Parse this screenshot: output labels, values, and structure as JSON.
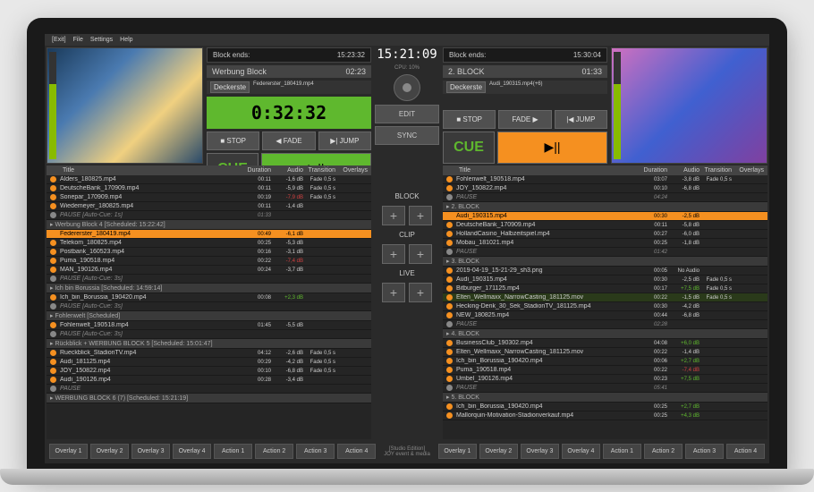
{
  "menu": {
    "exit": "[Exit]",
    "file": "File",
    "settings": "Settings",
    "help": "Help"
  },
  "deckA": {
    "block_ends_label": "Block ends:",
    "block_ends": "15:23:32",
    "title": "Werbung Block",
    "remain": "02:23",
    "file_btn": "Deckerste",
    "file": "Federerster_180419.mp4",
    "timer": "0:32:32",
    "stop": "■ STOP",
    "fade": "◀ FADE",
    "jump": "▶| JUMP",
    "cue": "CUE",
    "play": "▶||"
  },
  "deckB": {
    "block_ends_label": "Block ends:",
    "block_ends": "15:30:04",
    "title": "2. BLOCK",
    "remain": "01:33",
    "file_btn": "Deckerste",
    "file": "Audi_190315.mp4(+6)",
    "stop": "■ STOP",
    "fade": "FADE ▶",
    "jump": "|◀ JUMP",
    "cue": "CUE",
    "play": "▶||"
  },
  "center": {
    "clock": "15:21:09",
    "cpu": "CPU: 10%",
    "edit": "EDIT",
    "sync": "SYNC"
  },
  "mid": {
    "block": "BLOCK",
    "clip": "CLIP",
    "live": "LIVE"
  },
  "cols": {
    "title": "Title",
    "duration": "Duration",
    "audio": "Audio",
    "transition": "Transition",
    "overlays": "Overlays"
  },
  "playlistA": {
    "blocks": [
      {
        "header": "",
        "rows": [
          {
            "t": "Alders_180825.mp4",
            "d": "00:11",
            "a": "-1,6 dB",
            "tr": "Fade 0,5 s"
          },
          {
            "t": "DeutscheBank_170909.mp4",
            "d": "00:11",
            "a": "-5,9 dB",
            "tr": "Fade 0,5 s"
          },
          {
            "t": "Sonepar_170909.mp4",
            "d": "00:19",
            "a": "-7,9 dB",
            "tr": "Fade 0,5 s"
          },
          {
            "t": "Wiedemeyer_180825.mp4",
            "d": "00:11",
            "a": "-1,4 dB",
            "tr": ""
          },
          {
            "t": "PAUSE [Auto-Cue: 1s]",
            "d": "01:33",
            "pause": true
          }
        ]
      },
      {
        "header": "Werbung Block 4 [Scheduled: 15:22:42]",
        "orange": true,
        "rows": [
          {
            "t": "Federerster_180419.mp4",
            "d": "00:49",
            "a": "-6,1 dB",
            "tr": "",
            "hl": "orange"
          },
          {
            "t": "Telekom_180825.mp4",
            "d": "00:25",
            "a": "-5,3 dB",
            "tr": ""
          },
          {
            "t": "Postbank_160523.mp4",
            "d": "00:16",
            "a": "-3,1 dB",
            "tr": ""
          },
          {
            "t": "Puma_190518.mp4",
            "d": "00:22",
            "a": "-7,4 dB",
            "tr": ""
          },
          {
            "t": "MAN_190126.mp4",
            "d": "00:24",
            "a": "-3,7 dB",
            "tr": ""
          },
          {
            "t": "PAUSE [Auto-Cue: 3s]",
            "d": "",
            "pause": true
          }
        ]
      },
      {
        "header": "Ich bin Borussia [Scheduled: 14:59:14]",
        "rows": [
          {
            "t": "Ich_bin_Borussia_190420.mp4",
            "d": "00:08",
            "a": "+2,3 dB",
            "tr": ""
          },
          {
            "t": "PAUSE [Auto-Cue: 3s]",
            "d": "",
            "pause": true
          }
        ]
      },
      {
        "header": "Fohlenwelt [Scheduled]",
        "rows": [
          {
            "t": "Fohlenwelt_190518.mp4",
            "d": "01:45",
            "a": "-5,5 dB",
            "tr": ""
          },
          {
            "t": "PAUSE [Auto-Cue: 3s]",
            "d": "",
            "pause": true
          }
        ]
      },
      {
        "header": "Rückblick + WERBUNG BLOCK 5 [Scheduled: 15:01:47]",
        "rows": [
          {
            "t": "Rueckblick_StadionTV.mp4",
            "d": "04:12",
            "a": "-2,6 dB",
            "tr": "Fade 0,5 s"
          },
          {
            "t": "Audi_181125.mp4",
            "d": "00:29",
            "a": "-4,2 dB",
            "tr": "Fade 0,5 s"
          },
          {
            "t": "JOY_150822.mp4",
            "d": "00:10",
            "a": "-6,8 dB",
            "tr": "Fade 0,5 s"
          },
          {
            "t": "Audi_190126.mp4",
            "d": "00:28",
            "a": "-3,4 dB",
            "tr": ""
          },
          {
            "t": "PAUSE",
            "d": "",
            "pause": true
          }
        ]
      },
      {
        "header": "WERBUNG BLOCK 6 (7) [Scheduled: 15:21:19]",
        "rows": []
      }
    ]
  },
  "playlistB": {
    "blocks": [
      {
        "header": "",
        "rows": [
          {
            "t": "Fohlenwelt_190518.mp4",
            "d": "03:07",
            "a": "-3,8 dB",
            "tr": "Fade 0,5 s"
          },
          {
            "t": "JOY_150822.mp4",
            "d": "00:10",
            "a": "-6,8 dB",
            "tr": ""
          },
          {
            "t": "PAUSE",
            "d": "04:24",
            "pause": true
          }
        ]
      },
      {
        "header": "2. BLOCK",
        "rows": [
          {
            "t": "Audi_190315.mp4",
            "d": "00:30",
            "a": "-2,5 dB",
            "tr": "",
            "hl": "orange"
          },
          {
            "t": "DeutscheBank_170909.mp4",
            "d": "00:11",
            "a": "-5,8 dB",
            "tr": ""
          },
          {
            "t": "HollandCasino_Halbzeitspiel.mp4",
            "d": "00:27",
            "a": "-6,0 dB",
            "tr": ""
          },
          {
            "t": "Mobau_181021.mp4",
            "d": "00:25",
            "a": "-1,8 dB",
            "tr": ""
          },
          {
            "t": "PAUSE",
            "d": "01:42",
            "pause": true
          }
        ]
      },
      {
        "header": "3. BLOCK",
        "rows": [
          {
            "t": "2019-04-19_15-21-29_sh3.png",
            "d": "00:05",
            "a": "No Audio",
            "tr": ""
          },
          {
            "t": "Audi_190315.mp4",
            "d": "00:30",
            "a": "-2,5 dB",
            "tr": "Fade 0,5 s"
          },
          {
            "t": "Bitburger_171125.mp4",
            "d": "00:17",
            "a": "+7,5 dB",
            "tr": "Fade 0,5 s"
          },
          {
            "t": "Elten_Wellmaxx_NarrowCasting_181125.mov",
            "d": "00:22",
            "a": "-1,5 dB",
            "tr": "Fade 0,5 s",
            "hl": "green"
          },
          {
            "t": "Hecking-Denk_30_Sek_StadionTV_181125.mp4",
            "d": "00:30",
            "a": "-4,2 dB",
            "tr": ""
          },
          {
            "t": "NEW_180825.mp4",
            "d": "00:44",
            "a": "-6,8 dB",
            "tr": ""
          },
          {
            "t": "PAUSE",
            "d": "02:28",
            "pause": true
          }
        ]
      },
      {
        "header": "4. BLOCK",
        "rows": [
          {
            "t": "BusinessClub_190302.mp4",
            "d": "04:08",
            "a": "+6,0 dB",
            "tr": ""
          },
          {
            "t": "Elten_Wellmaxx_NarrowCasting_181125.mov",
            "d": "00:22",
            "a": "-1,4 dB",
            "tr": ""
          },
          {
            "t": "Ich_bin_Borussia_190420.mp4",
            "d": "00:06",
            "a": "+2,7 dB",
            "tr": ""
          },
          {
            "t": "Puma_190518.mp4",
            "d": "00:22",
            "a": "-7,4 dB",
            "tr": ""
          },
          {
            "t": "Umbel_190126.mp4",
            "d": "00:23",
            "a": "+7,5 dB",
            "tr": ""
          },
          {
            "t": "PAUSE",
            "d": "05:41",
            "pause": true
          }
        ]
      },
      {
        "header": "5. BLOCK",
        "rows": [
          {
            "t": "Ich_bin_Borussia_190420.mp4",
            "d": "00:25",
            "a": "+2,7 dB",
            "tr": ""
          },
          {
            "t": "Mallorquin-Motivation-Stadionverkauf.mp4",
            "d": "00:25",
            "a": "+4,3 dB",
            "tr": ""
          }
        ]
      }
    ]
  },
  "overlaysA": [
    "Overlay 1",
    "Overlay 2",
    "Overlay 3",
    "Overlay 4",
    "Action 1",
    "Action 2",
    "Action 3",
    "Action 4"
  ],
  "overlaysB": [
    "Overlay 1",
    "Overlay 2",
    "Overlay 3",
    "Overlay 4",
    "Action 1",
    "Action 2",
    "Action 3",
    "Action 4"
  ],
  "edition": {
    "name": "[Studio Edition]",
    "vendor": "JOY event & media"
  }
}
